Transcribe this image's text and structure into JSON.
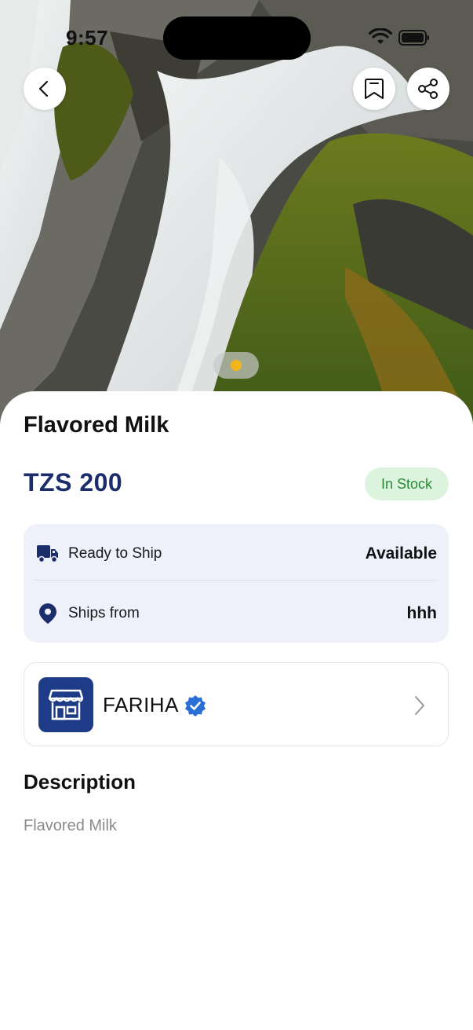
{
  "status_bar": {
    "time": "9:57"
  },
  "hero": {
    "pager_active_color": "#f2b51b"
  },
  "product": {
    "title": "Flavored Milk",
    "price": "TZS 200",
    "stock_status": "In Stock"
  },
  "shipping": {
    "ready_label": "Ready to Ship",
    "ready_value": "Available",
    "ships_from_label": "Ships from",
    "ships_from_value": "hhh"
  },
  "store": {
    "name": "FARIHA",
    "verified": true
  },
  "description": {
    "heading": "Description",
    "text": "Flavored Milk"
  },
  "colors": {
    "brand": "#1b2e6b",
    "stock_badge_bg": "#dcf3dd",
    "stock_badge_text": "#2a8a3a",
    "info_card_bg": "#eef1fa",
    "verified": "#2a6fd6"
  },
  "icons": {
    "back": "chevron-left-icon",
    "bookmark": "bookmark-icon",
    "share": "share-icon",
    "truck": "truck-icon",
    "location": "location-pin-icon",
    "store": "storefront-icon",
    "verified": "verified-badge-icon",
    "chevron": "chevron-right-icon"
  }
}
